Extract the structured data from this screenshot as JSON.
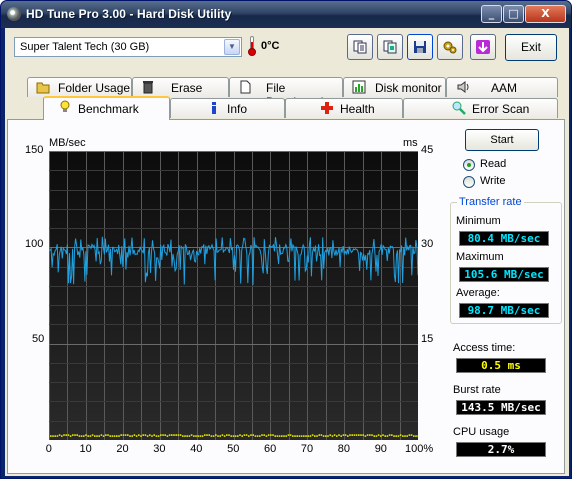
{
  "window": {
    "title": "HD Tune Pro 3.00 - Hard Disk Utility",
    "controls": [
      "_",
      "□",
      "X"
    ]
  },
  "toolbar": {
    "drive": "Super Talent Tech (30 GB)",
    "temperature": "0°C",
    "exit_label": "Exit",
    "icons": [
      "copy-text-icon",
      "copy-screenshot-icon",
      "save-icon",
      "settings-icon",
      "down-arrow-icon"
    ]
  },
  "tabs": {
    "row1": [
      {
        "label": "Folder Usage",
        "icon": "folder-icon"
      },
      {
        "label": "Erase",
        "icon": "trash-icon"
      },
      {
        "label": "File Benchmark",
        "icon": "document-icon"
      },
      {
        "label": "Disk monitor",
        "icon": "bar-chart-icon"
      },
      {
        "label": "AAM",
        "icon": "speaker-icon"
      }
    ],
    "row2": [
      {
        "label": "Benchmark",
        "icon": "lightbulb-icon",
        "active": true
      },
      {
        "label": "Info",
        "icon": "info-icon"
      },
      {
        "label": "Health",
        "icon": "health-cross-icon"
      },
      {
        "label": "Error Scan",
        "icon": "magnifier-icon"
      }
    ]
  },
  "chart_data": {
    "type": "line",
    "y_left_unit": "MB/sec",
    "y_right_unit": "ms",
    "y_left_ticks": [
      "150",
      "100",
      "50"
    ],
    "y_right_ticks": [
      "45",
      "30",
      "15"
    ],
    "ylim_left": [
      0,
      150
    ],
    "ylim_right": [
      0,
      45
    ],
    "x_ticks": [
      "0",
      "10",
      "20",
      "30",
      "40",
      "50",
      "60",
      "70",
      "80",
      "90",
      "100%"
    ],
    "xlim": [
      0,
      100
    ],
    "grid": true,
    "colors": {
      "transfer": "#1fa0e0",
      "access": "#e8e800",
      "background": "#000000",
      "grid": "#5a5a5a"
    },
    "series": [
      {
        "name": "Transfer rate",
        "unit": "MB/sec",
        "min": 80.4,
        "max": 105.6,
        "average": 98.7
      },
      {
        "name": "Access time",
        "unit": "ms",
        "average": 0.5
      }
    ]
  },
  "controls": {
    "start_label": "Start",
    "read_label": "Read",
    "write_label": "Write",
    "selected": "Read"
  },
  "stats": {
    "transfer_rate_title": "Transfer rate",
    "minimum_label": "Minimum",
    "minimum_value": "80.4 MB/sec",
    "maximum_label": "Maximum",
    "maximum_value": "105.6 MB/sec",
    "average_label": "Average:",
    "average_value": "98.7 MB/sec",
    "access_time_label": "Access time:",
    "access_time_value": "0.5 ms",
    "burst_rate_label": "Burst rate",
    "burst_rate_value": "143.5 MB/sec",
    "cpu_usage_label": "CPU usage",
    "cpu_usage_value": "2.7%"
  }
}
